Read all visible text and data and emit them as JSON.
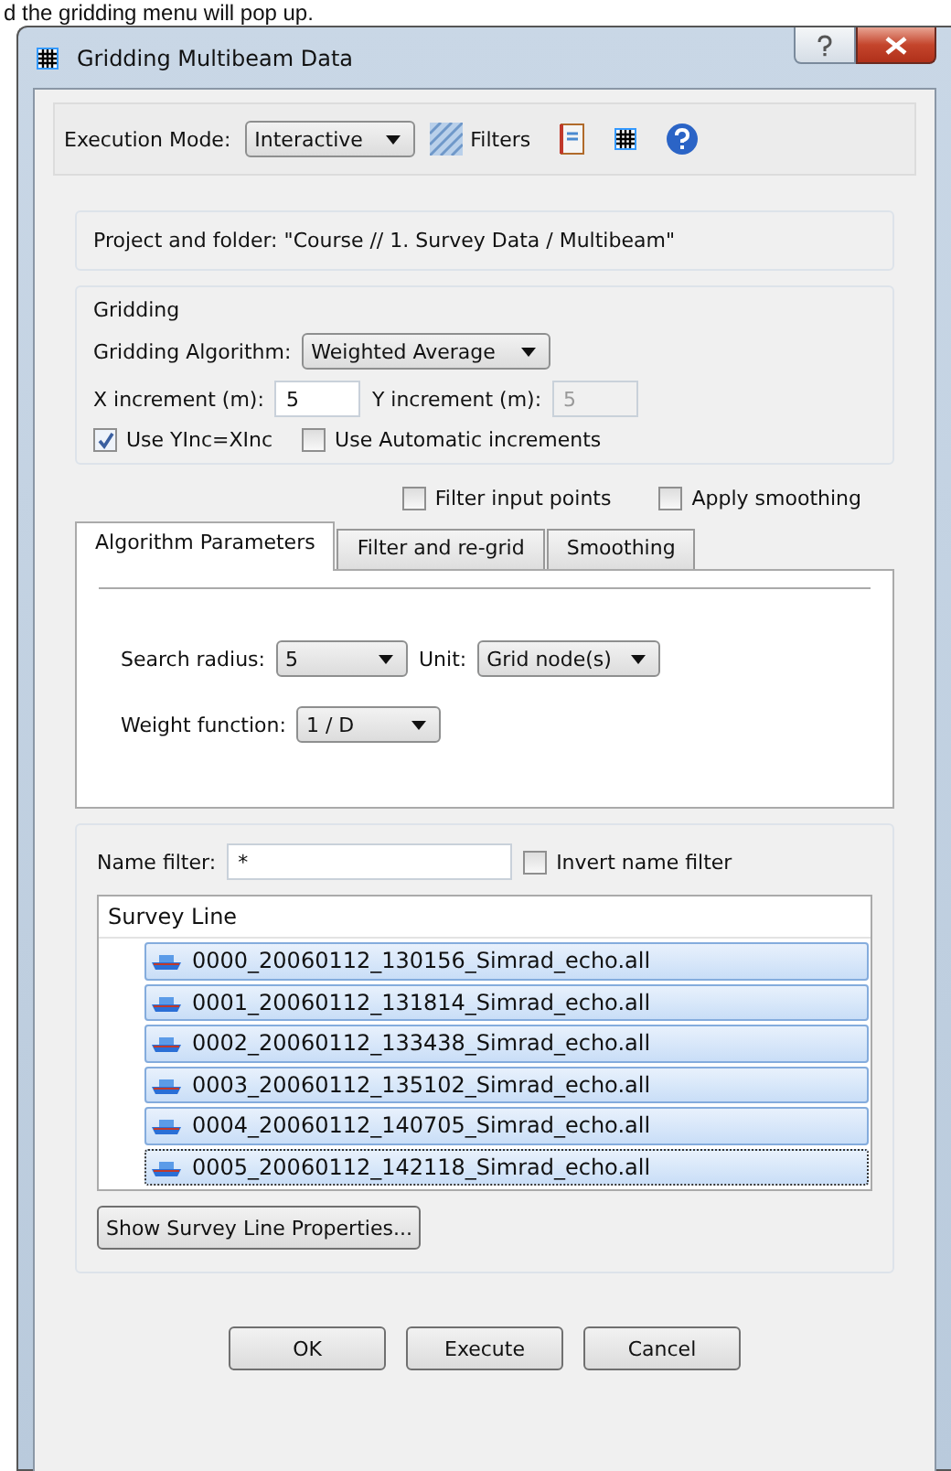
{
  "caption": "d the gridding menu will pop up.",
  "window": {
    "title": "Gridding Multibeam Data"
  },
  "toolbar": {
    "execution_mode_label": "Execution Mode:",
    "execution_mode": "Interactive",
    "filters_label": "Filters"
  },
  "project_folder": "Project and folder: \"Course // 1. Survey Data / Multibeam\"",
  "gridding": {
    "title": "Gridding",
    "algorithm_label": "Gridding Algorithm:",
    "algorithm": "Weighted Average",
    "x_label": "X increment (m):",
    "x_value": "5",
    "y_label": "Y increment (m):",
    "y_value": "5",
    "y_disabled": true,
    "options": [
      {
        "label": "Use YInc=XInc",
        "checked": true
      },
      {
        "label": "Use Automatic increments",
        "checked": false
      }
    ]
  },
  "extra_options": [
    {
      "label": "Filter input points",
      "checked": false
    },
    {
      "label": "Apply smoothing",
      "checked": false
    }
  ],
  "tabs": [
    {
      "label": "Algorithm Parameters",
      "selected": true
    },
    {
      "label": "Filter and re-grid",
      "selected": false
    },
    {
      "label": "Smoothing",
      "selected": false
    }
  ],
  "algorithm_parameters": {
    "search_radius_label": "Search radius:",
    "search_radius": "5",
    "unit_label": "Unit:",
    "unit": "Grid node(s)",
    "weight_label": "Weight function:",
    "weight": "1 / D"
  },
  "files": {
    "name_filter_label": "Name filter:",
    "name_filter": "*",
    "invert": {
      "label": "Invert name filter",
      "checked": false
    },
    "column": "Survey Line",
    "rows": [
      {
        "name": "0000_20060112_130156_Simrad_echo.all",
        "selected": true,
        "focused": false
      },
      {
        "name": "0001_20060112_131814_Simrad_echo.all",
        "selected": true,
        "focused": false
      },
      {
        "name": "0002_20060112_133438_Simrad_echo.all",
        "selected": true,
        "focused": false
      },
      {
        "name": "0003_20060112_135102_Simrad_echo.all",
        "selected": true,
        "focused": false
      },
      {
        "name": "0004_20060112_140705_Simrad_echo.all",
        "selected": true,
        "focused": false
      },
      {
        "name": "0005_20060112_142118_Simrad_echo.all",
        "selected": true,
        "focused": true
      }
    ],
    "properties_button": "Show Survey Line Properties..."
  },
  "buttons": [
    "OK",
    "Execute",
    "Cancel"
  ]
}
